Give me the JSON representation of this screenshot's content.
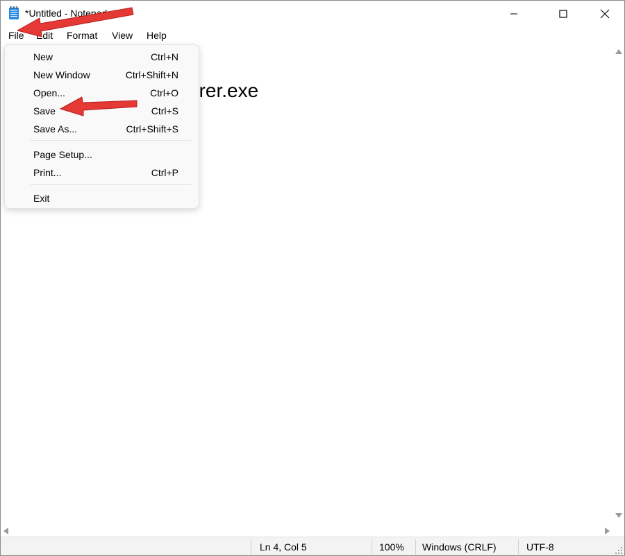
{
  "window": {
    "title": "*Untitled - Notepad"
  },
  "menubar": {
    "items": [
      {
        "label": "File"
      },
      {
        "label": "Edit"
      },
      {
        "label": "Format"
      },
      {
        "label": "View"
      },
      {
        "label": "Help"
      }
    ]
  },
  "file_menu": {
    "items": [
      {
        "label": "New",
        "shortcut": "Ctrl+N"
      },
      {
        "label": "New Window",
        "shortcut": "Ctrl+Shift+N"
      },
      {
        "label": "Open...",
        "shortcut": "Ctrl+O"
      },
      {
        "label": "Save",
        "shortcut": "Ctrl+S"
      },
      {
        "label": "Save As...",
        "shortcut": "Ctrl+Shift+S"
      },
      {
        "label": "Page Setup...",
        "shortcut": ""
      },
      {
        "label": "Print...",
        "shortcut": "Ctrl+P"
      },
      {
        "label": "Exit",
        "shortcut": ""
      }
    ]
  },
  "editor": {
    "visible_text": "orer.exe"
  },
  "statusbar": {
    "position": "Ln 4, Col 5",
    "zoom": "100%",
    "line_ending": "Windows (CRLF)",
    "encoding": "UTF-8"
  },
  "icons": {
    "app": "notepad-icon",
    "minimize": "minimize-icon",
    "maximize": "maximize-icon",
    "close": "close-icon"
  },
  "colors": {
    "annotation_arrow": "#e53935",
    "menu_background": "#f9f9f9",
    "statusbar_background": "#f3f3f3",
    "notepad_icon": "#1e88e5"
  }
}
